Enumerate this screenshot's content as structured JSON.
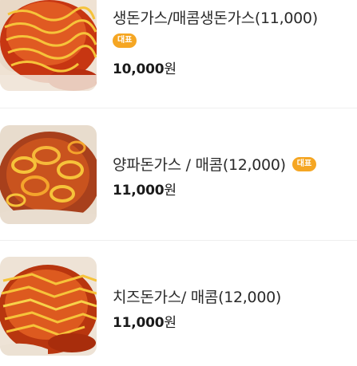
{
  "menu": {
    "items": [
      {
        "name": "생돈가스/매콤생돈가스(11,000)",
        "badge": "대표",
        "price_number": "10,000",
        "price_unit": "원",
        "image": "tonkatsu-photo"
      },
      {
        "name": "양파돈가스 / 매콤(12,000)",
        "badge": "대표",
        "price_number": "11,000",
        "price_unit": "원",
        "image": "onion-tonkatsu-photo"
      },
      {
        "name": "치즈돈가스/ 매콤(12,000)",
        "badge": "",
        "price_number": "11,000",
        "price_unit": "원",
        "image": "cheese-tonkatsu-photo"
      }
    ]
  },
  "colors": {
    "badge": "#f5a623",
    "divider": "#efefef",
    "sauce": "#d9461a",
    "mayo": "#f6c33a"
  }
}
